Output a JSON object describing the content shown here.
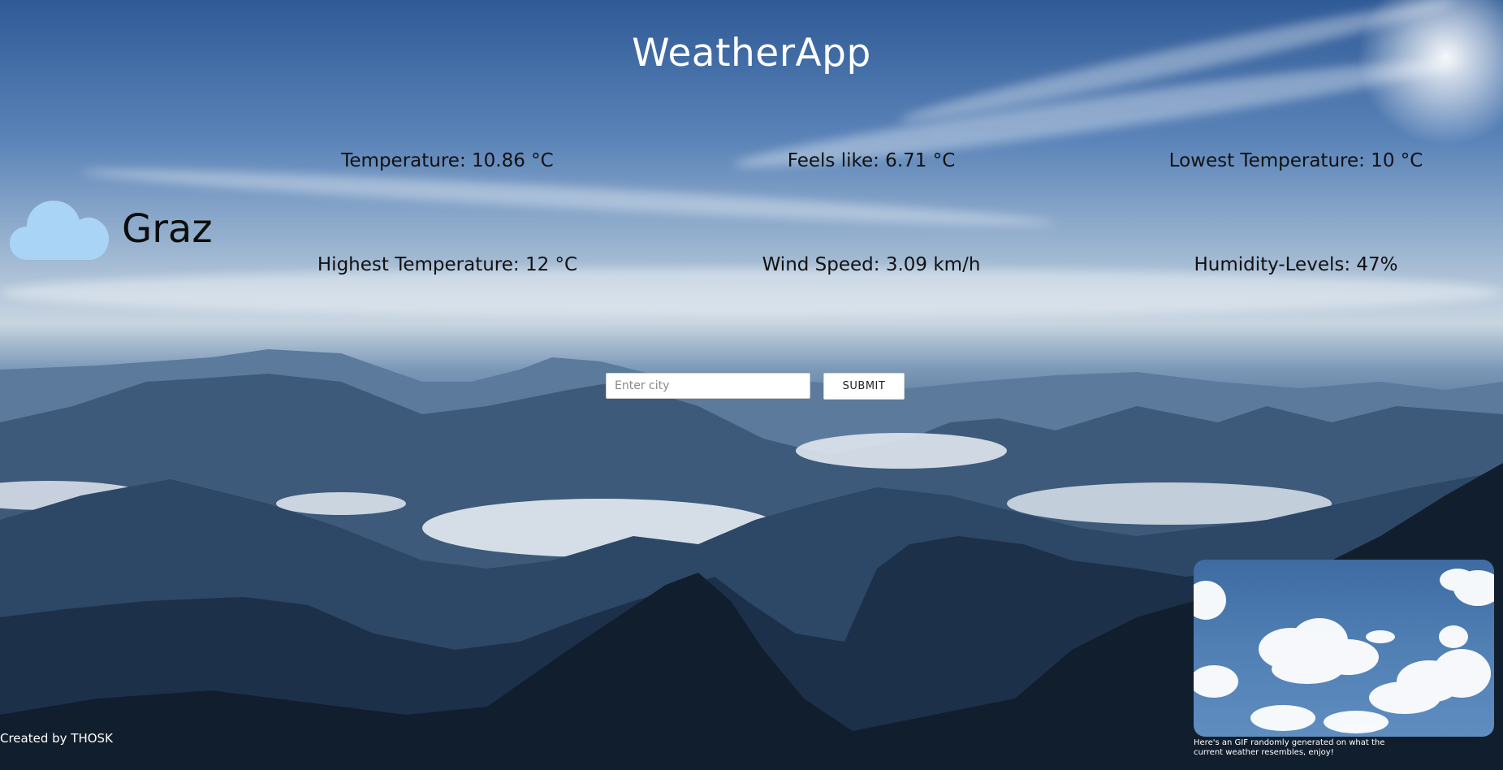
{
  "app": {
    "title": "WeatherApp"
  },
  "location": {
    "city": "Graz",
    "icon": "cloud-icon"
  },
  "stats": {
    "temperature": "Temperature: 10.86 °C",
    "feels_like": "Feels like: 6.71 °C",
    "lowest_temperature": "Lowest Temperature: 10 °C",
    "highest_temperature": "Highest Temperature: 12 °C",
    "wind_speed": "Wind Speed: 3.09 km/h",
    "humidity": "Humidity-Levels: 47%"
  },
  "search": {
    "placeholder": "Enter city",
    "value": "",
    "submit_label": "SUBMIT"
  },
  "gif": {
    "caption": "Here's an GIF randomly generated on what the current weather resembles, enjoy!"
  },
  "footer": {
    "credit": "Created by THOSK"
  },
  "colors": {
    "cloud_icon": "#a9d4f5",
    "text_dark": "#111111",
    "text_light": "#ffffff"
  }
}
